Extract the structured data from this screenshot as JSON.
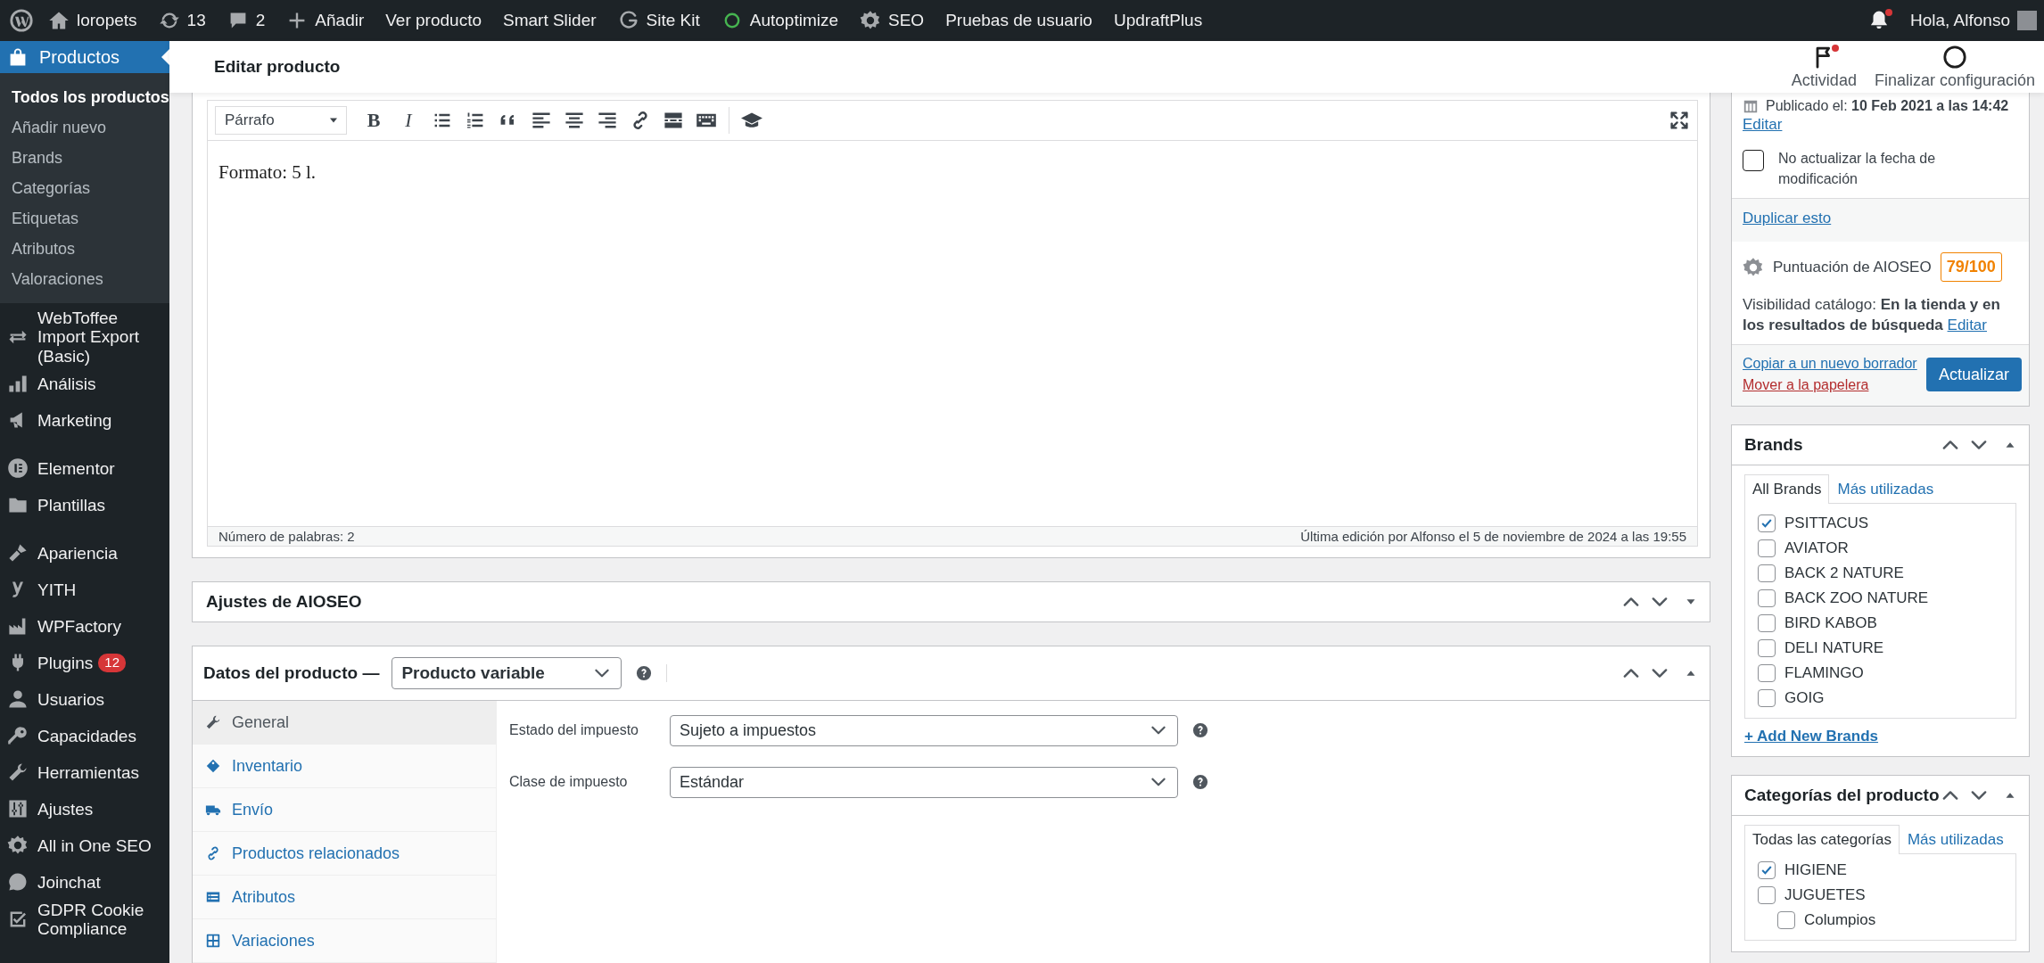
{
  "admin_bar": {
    "items": [
      {
        "label": "loropets"
      },
      {
        "label": "13"
      },
      {
        "label": "2"
      },
      {
        "label": "Añadir"
      },
      {
        "label": "Ver producto"
      },
      {
        "label": "Smart Slider"
      },
      {
        "label": "Site Kit"
      },
      {
        "label": "Autoptimize"
      },
      {
        "label": "SEO"
      },
      {
        "label": "Pruebas de usuario"
      },
      {
        "label": "UpdraftPlus"
      }
    ],
    "greeting": "Hola, Alfonso"
  },
  "sidebar": {
    "current": {
      "label": "Productos",
      "selected": true
    },
    "submenu": [
      {
        "label": "Todos los productos",
        "selected": true
      },
      {
        "label": "Añadir nuevo",
        "selected": false
      },
      {
        "label": "Brands",
        "selected": false
      },
      {
        "label": "Categorías",
        "selected": false
      },
      {
        "label": "Etiquetas",
        "selected": false
      },
      {
        "label": "Atributos",
        "selected": false
      },
      {
        "label": "Valoraciones",
        "selected": false
      }
    ],
    "groups": [
      [
        {
          "label": "WebToffee Import Export (Basic)"
        },
        {
          "label": "Análisis"
        },
        {
          "label": "Marketing"
        }
      ],
      [
        {
          "label": "Elementor"
        },
        {
          "label": "Plantillas"
        }
      ],
      [
        {
          "label": "Apariencia"
        },
        {
          "label": "YITH"
        },
        {
          "label": "WPFactory"
        },
        {
          "label": "Plugins",
          "badge": "12"
        },
        {
          "label": "Usuarios"
        },
        {
          "label": "Capacidades"
        },
        {
          "label": "Herramientas"
        },
        {
          "label": "Ajustes"
        },
        {
          "label": "All in One SEO"
        },
        {
          "label": "Joinchat"
        },
        {
          "label": "GDPR Cookie Compliance"
        }
      ]
    ]
  },
  "header": {
    "title": "Editar producto",
    "actions": [
      {
        "label": "Actividad"
      },
      {
        "label": "Finalizar configuración"
      }
    ]
  },
  "editor": {
    "format": "Párrafo",
    "letter_buttons": [
      "B",
      "I"
    ],
    "content": "Formato: 5 l.",
    "word_count": "Número de palabras: 2",
    "last_edit": "Última edición por Alfonso el 5 de noviembre de 2024 a las 19:55"
  },
  "aioseo_box": {
    "title": "Ajustes de AIOSEO",
    "expanded": false
  },
  "product_data": {
    "title": "Datos del producto —",
    "type": "Producto variable",
    "expanded": true,
    "tabs": [
      {
        "label": "General",
        "selected": true
      },
      {
        "label": "Inventario",
        "selected": false
      },
      {
        "label": "Envío",
        "selected": false
      },
      {
        "label": "Productos relacionados",
        "selected": false
      },
      {
        "label": "Atributos",
        "selected": false
      },
      {
        "label": "Variaciones",
        "selected": false
      }
    ],
    "fields": [
      {
        "label": "Estado del impuesto",
        "value": "Sujeto a impuestos"
      },
      {
        "label": "Clase de impuesto",
        "value": "Estándar"
      }
    ]
  },
  "publish_box": {
    "published": "Publicado el: **10 Feb 2021 a las 14:42**",
    "edit_link": "Editar",
    "no_update": {
      "label": "No actualizar la fecha de modificación",
      "checked": false
    },
    "duplicate": "Duplicar esto",
    "score_label": "Puntuación de AIOSEO",
    "score": "79/100",
    "visibility": "Visibilidad catálogo: **En la tienda y en los resultados de búsqueda**",
    "visibility_edit": "Editar",
    "copy_draft": "Copiar a un nuevo borrador",
    "trash": "Mover a la papelera",
    "update": "Actualizar"
  },
  "brands_box": {
    "title": "Brands",
    "expanded": true,
    "tabs": [
      {
        "label": "All Brands",
        "selected": true
      },
      {
        "label": "Más utilizadas",
        "selected": false
      }
    ],
    "items": [
      {
        "label": "PSITTACUS",
        "checked": true
      },
      {
        "label": "AVIATOR",
        "checked": false
      },
      {
        "label": "BACK 2 NATURE",
        "checked": false
      },
      {
        "label": "BACK ZOO NATURE",
        "checked": false
      },
      {
        "label": "BIRD KABOB",
        "checked": false
      },
      {
        "label": "DELI NATURE",
        "checked": false
      },
      {
        "label": "FLAMINGO",
        "checked": false
      },
      {
        "label": "GOIG",
        "checked": false
      }
    ],
    "add_link": "+ Add New Brands"
  },
  "categories_box": {
    "title": "Categorías del producto",
    "expanded": true,
    "tabs": [
      {
        "label": "Todas las categorías",
        "selected": true
      },
      {
        "label": "Más utilizadas",
        "selected": false
      }
    ],
    "items": [
      {
        "label": "HIGIENE",
        "checked": true
      },
      {
        "label": "JUGUETES",
        "checked": false,
        "children": [
          {
            "label": "Columpios",
            "checked": false
          }
        ]
      }
    ]
  }
}
